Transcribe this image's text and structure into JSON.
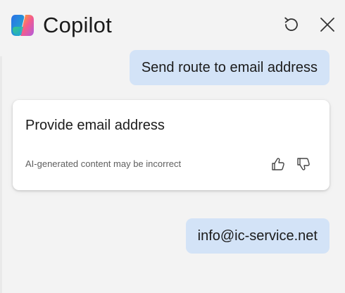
{
  "header": {
    "title": "Copilot",
    "logo_icon": "copilot-logo",
    "refresh_icon": "refresh-icon",
    "close_icon": "close-icon"
  },
  "messages": [
    {
      "role": "user",
      "text": "Send route to email address"
    },
    {
      "role": "assistant",
      "text": "Provide email address",
      "disclaimer": "AI-generated content may be incorrect",
      "feedback_icons": [
        "thumbs-up-icon",
        "thumbs-down-icon"
      ]
    },
    {
      "role": "user",
      "text": "info@ic-service.net"
    }
  ],
  "colors": {
    "background": "#f3f3f3",
    "user_bubble": "#d3e3f7",
    "card": "#ffffff",
    "text": "#1b1b1b",
    "muted_text": "#5f5f5f"
  }
}
